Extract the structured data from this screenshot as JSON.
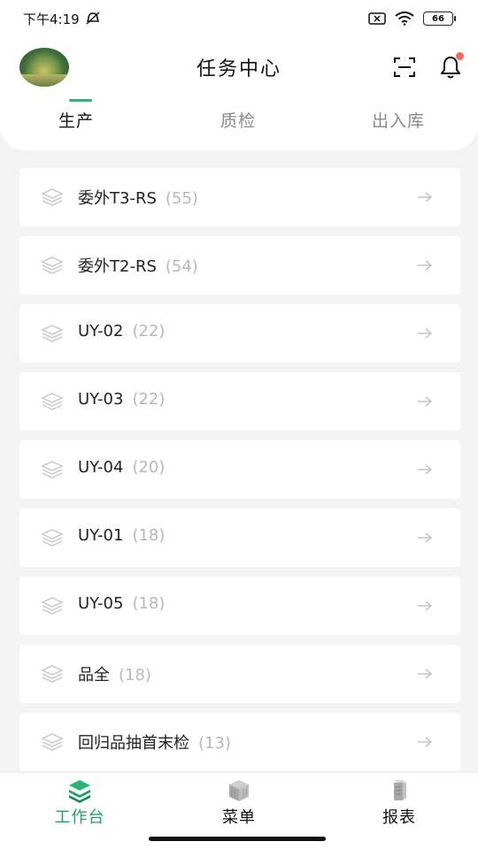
{
  "status_bar": {
    "time": "下午4:19",
    "battery": "66"
  },
  "header": {
    "title": "任务中心",
    "tabs": [
      {
        "label": "生产",
        "active": true
      },
      {
        "label": "质检",
        "active": false
      },
      {
        "label": "出入库",
        "active": false
      }
    ]
  },
  "colors": {
    "accent": "#2db37a",
    "active_nav": "#1f9e66",
    "notification_dot": "#f06a5e",
    "background": "#f3f3f3",
    "count_text": "#b8b8b8"
  },
  "tasks": [
    {
      "name": "委外T3-RS",
      "count": "(55)"
    },
    {
      "name": "委外T2-RS",
      "count": "(54)"
    },
    {
      "name": "UY-02",
      "count": "(22)"
    },
    {
      "name": "UY-03",
      "count": "(22)"
    },
    {
      "name": "UY-04",
      "count": "(20)"
    },
    {
      "name": "UY-01",
      "count": "(18)"
    },
    {
      "name": "UY-05",
      "count": "(18)"
    },
    {
      "name": "品全",
      "count": "(18)"
    },
    {
      "name": "回归品抽首末检",
      "count": "(13)"
    }
  ],
  "bottom_nav": [
    {
      "label": "工作台",
      "icon": "layers-icon",
      "active": true
    },
    {
      "label": "菜单",
      "icon": "menu-cube-icon",
      "active": false
    },
    {
      "label": "报表",
      "icon": "report-icon",
      "active": false
    }
  ]
}
